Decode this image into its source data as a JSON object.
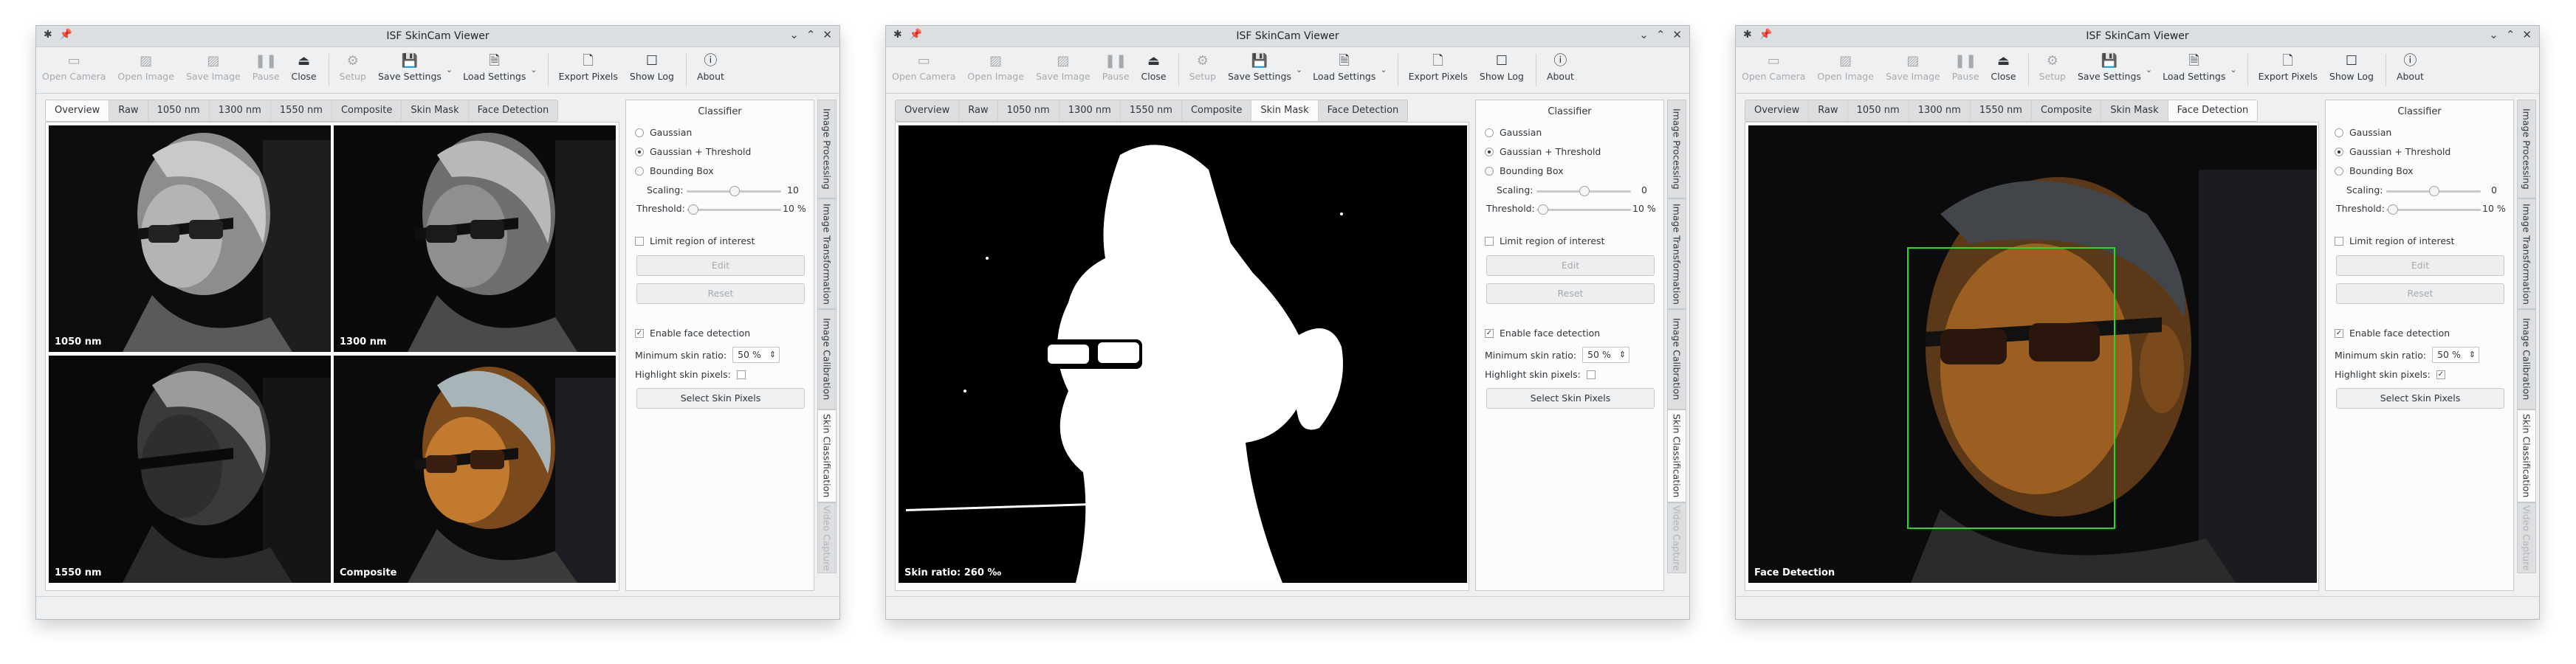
{
  "window": {
    "title": "ISF SkinCam Viewer"
  },
  "titlebar_icons": {
    "left": [
      "app-icon",
      "pin-icon"
    ],
    "right": [
      "chevron-down-icon",
      "chevron-up-icon",
      "close-icon"
    ]
  },
  "toolbar": {
    "open_camera": "Open Camera",
    "open_image": "Open Image",
    "save_image": "Save Image",
    "pause": "Pause",
    "close": "Close",
    "setup": "Setup",
    "save_settings": "Save Settings",
    "load_settings": "Load Settings",
    "export_pixels": "Export Pixels",
    "show_log": "Show Log",
    "about": "About"
  },
  "tabs": [
    "Overview",
    "Raw",
    "1050 nm",
    "1300 nm",
    "1550 nm",
    "Composite",
    "Skin Mask",
    "Face Detection"
  ],
  "overview_labels": [
    "1050 nm",
    "1300 nm",
    "1550 nm",
    "Composite"
  ],
  "skin_mask_label": "Skin ratio: 260 ‰",
  "face_detection_label": "Face Detection",
  "classifier": {
    "title": "Classifier",
    "options": [
      "Gaussian",
      "Gaussian + Threshold",
      "Bounding Box"
    ],
    "selected": "Gaussian + Threshold",
    "scaling_label": "Scaling:",
    "threshold_label": "Threshold:",
    "threshold_value": "10 %",
    "limit_roi": "Limit region of interest",
    "edit": "Edit",
    "reset": "Reset",
    "enable_face_detection": "Enable face detection",
    "min_skin_ratio_label": "Minimum skin ratio:",
    "min_skin_ratio_value": "50 %",
    "highlight_skin_pixels": "Highlight skin pixels:",
    "select_skin_pixels": "Select Skin Pixels"
  },
  "side_tabs": [
    "Image Processing",
    "Image Transformation",
    "Image Calibration",
    "Skin Classification",
    "Video Capture"
  ],
  "windows": [
    {
      "active_tab": "Overview",
      "scaling_value": "10",
      "highlight_checked": false
    },
    {
      "active_tab": "Skin Mask",
      "scaling_value": "0",
      "highlight_checked": false
    },
    {
      "active_tab": "Face Detection",
      "scaling_value": "0",
      "highlight_checked": true
    }
  ],
  "colors": {
    "window_bg": "#eff0f1",
    "face_box": "#22dd22",
    "composite_face": "#b56a26"
  }
}
